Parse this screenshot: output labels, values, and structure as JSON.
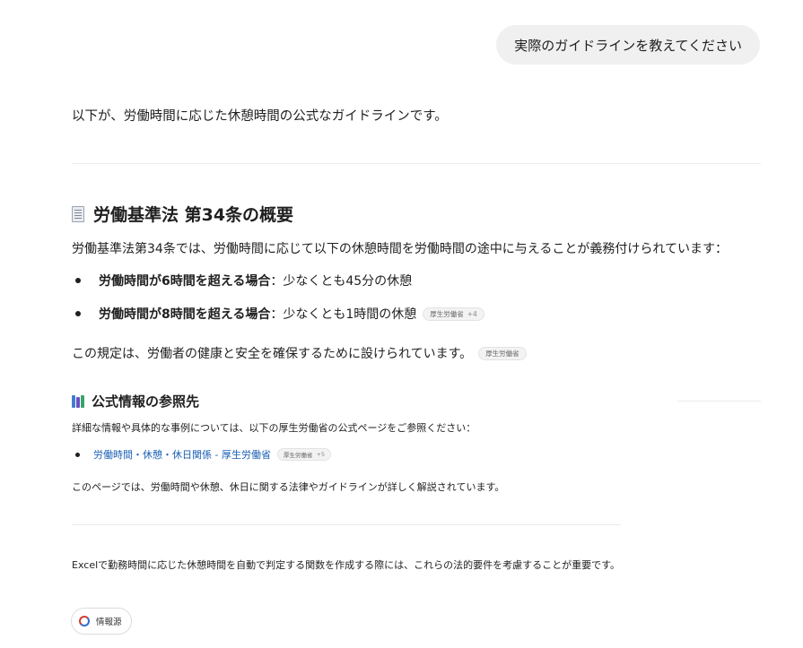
{
  "user_message": "実際のガイドラインを教えてください",
  "intro": "以下が、労働時間に応じた休憩時間の公式なガイドラインです。",
  "section1": {
    "heading": "労働基準法 第34条の概要",
    "heading_icon": "document-icon",
    "lead": "労働基準法第34条では、労働時間に応じて以下の休憩時間を労働時間の途中に与えることが義務付けられています：",
    "bullets": [
      {
        "bold": "労働時間が6時間を超える場合",
        "sep": "：",
        "text": "少なくとも45分の休憩"
      },
      {
        "bold": "労働時間が8時間を超える場合",
        "sep": "：",
        "text": "少なくとも1時間の休憩",
        "chip": "厚生労働省",
        "chip_count": "+4"
      }
    ],
    "rule": "この規定は、労働者の健康と安全を確保するために設けられています。",
    "rule_chip": "厚生労働省"
  },
  "section2": {
    "heading": "公式情報の参照先",
    "heading_icon": "books-icon",
    "intro": "詳細な情報や具体的な事例については、以下の厚生労働省の公式ページをご参照ください：",
    "link": {
      "text": "労働時間・休憩・休日関係 - 厚生労働省",
      "chip": "厚生労働省",
      "chip_count": "+5"
    },
    "desc": "このページでは、労働時間や休憩、休日に関する法律やガイドラインが詳しく解説されています。"
  },
  "final": "Excelで勤務時間に応じた休憩時間を自動で判定する関数を作成する際には、これらの法的要件を考慮することが重要です。",
  "sources_button": "情報源"
}
